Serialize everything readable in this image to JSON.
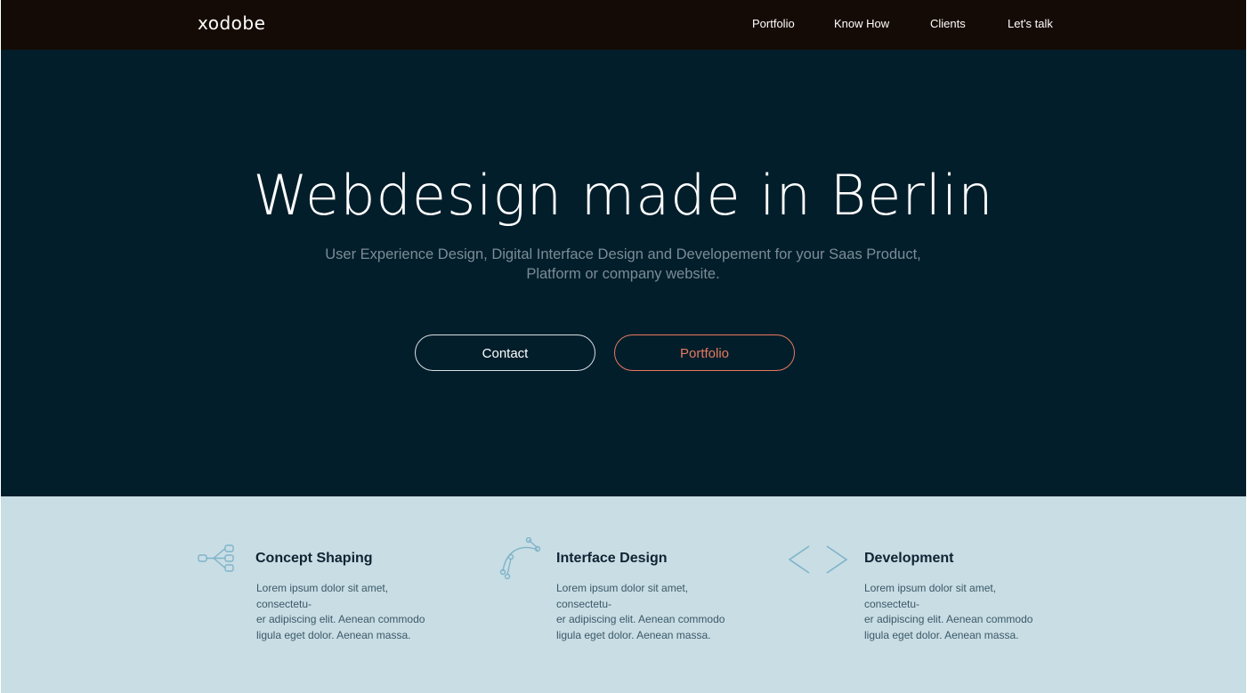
{
  "nav": {
    "logo": "xodobe",
    "links": [
      "Portfolio",
      "Know How",
      "Clients",
      "Let's talk"
    ]
  },
  "hero": {
    "title": "Webdesign made in Berlin",
    "subtitle_line1": "User Experience Design, Digital Interface Design and Developement for your Saas Product,",
    "subtitle_line2": "Platform or company website.",
    "contact_label": "Contact",
    "portfolio_label": "Portfolio"
  },
  "features": [
    {
      "icon": "sitemap-icon",
      "title": "Concept Shaping",
      "text_line1": "Lorem ipsum dolor sit amet, consectetu-",
      "text_line2": "er adipiscing elit. Aenean commodo",
      "text_line3": "ligula eget dolor. Aenean massa."
    },
    {
      "icon": "bezier-curve-icon",
      "title": "Interface Design",
      "text_line1": "Lorem ipsum dolor sit amet, consectetu-",
      "text_line2": "er adipiscing elit. Aenean commodo",
      "text_line3": "ligula eget dolor. Aenean massa."
    },
    {
      "icon": "code-brackets-icon",
      "title": "Development",
      "text_line1": "Lorem ipsum dolor sit amet, consectetu-",
      "text_line2": "er adipiscing elit. Aenean commodo",
      "text_line3": "ligula eget dolor. Aenean massa."
    }
  ],
  "colors": {
    "nav_bg": "#150b06",
    "hero_bg": "#031e2b",
    "accent": "#e8795f",
    "features_bg": "#c9dde4",
    "icon": "#7fb4c9"
  }
}
